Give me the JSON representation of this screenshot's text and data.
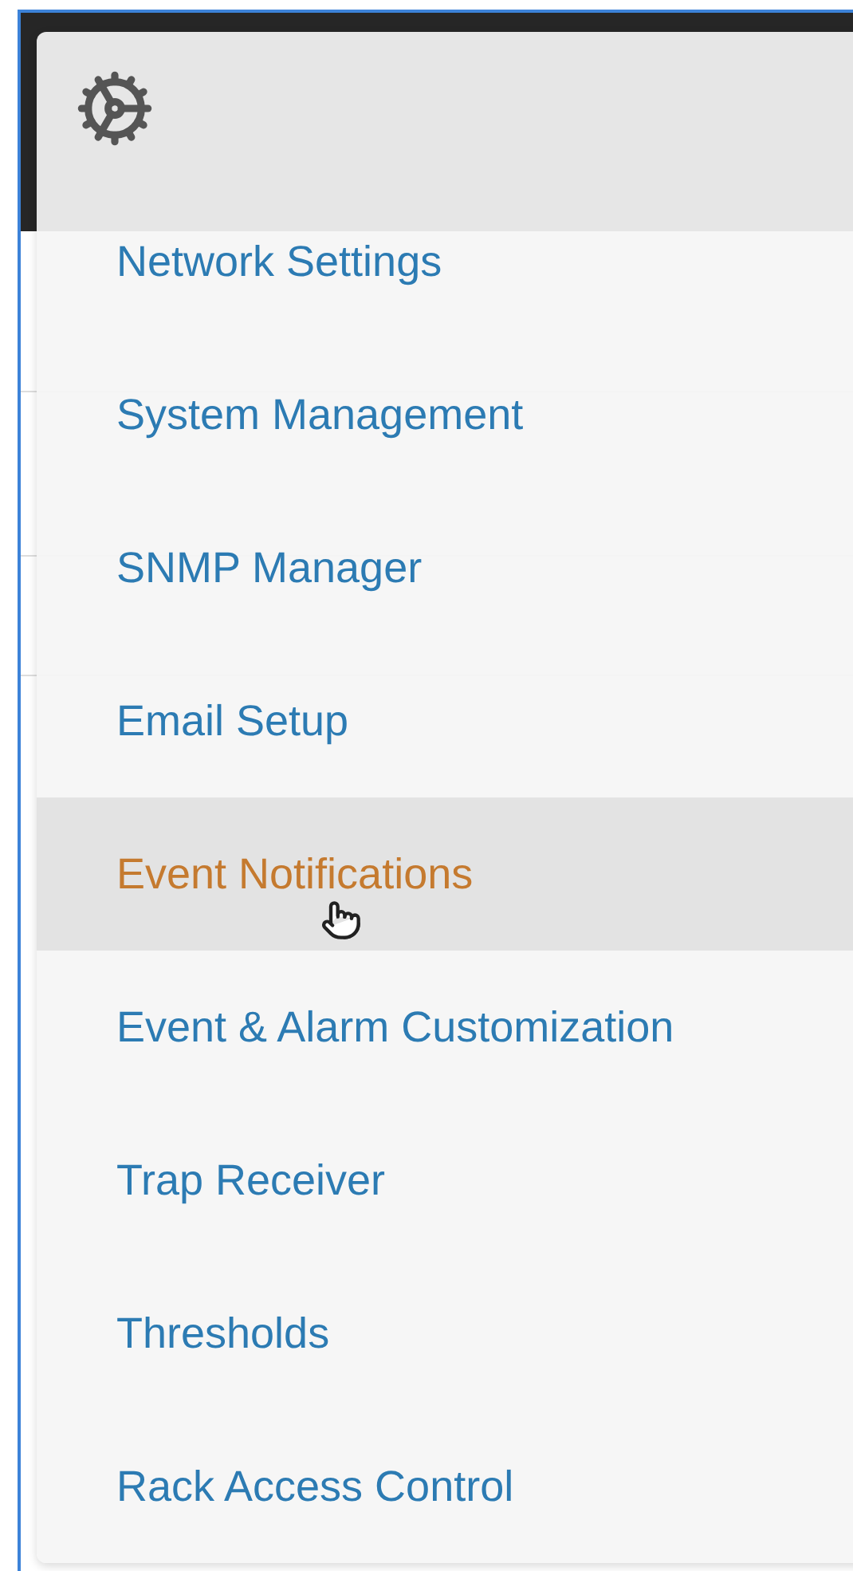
{
  "menu": {
    "items": [
      {
        "label": "Network Settings",
        "hovered": false
      },
      {
        "label": "System Management",
        "hovered": false
      },
      {
        "label": "SNMP Manager",
        "hovered": false
      },
      {
        "label": "Email Setup",
        "hovered": false
      },
      {
        "label": "Event Notifications",
        "hovered": true
      },
      {
        "label": "Event & Alarm Customization",
        "hovered": false
      },
      {
        "label": "Trap Receiver",
        "hovered": false
      },
      {
        "label": "Thresholds",
        "hovered": false
      },
      {
        "label": "Rack Access Control",
        "hovered": false
      }
    ]
  }
}
